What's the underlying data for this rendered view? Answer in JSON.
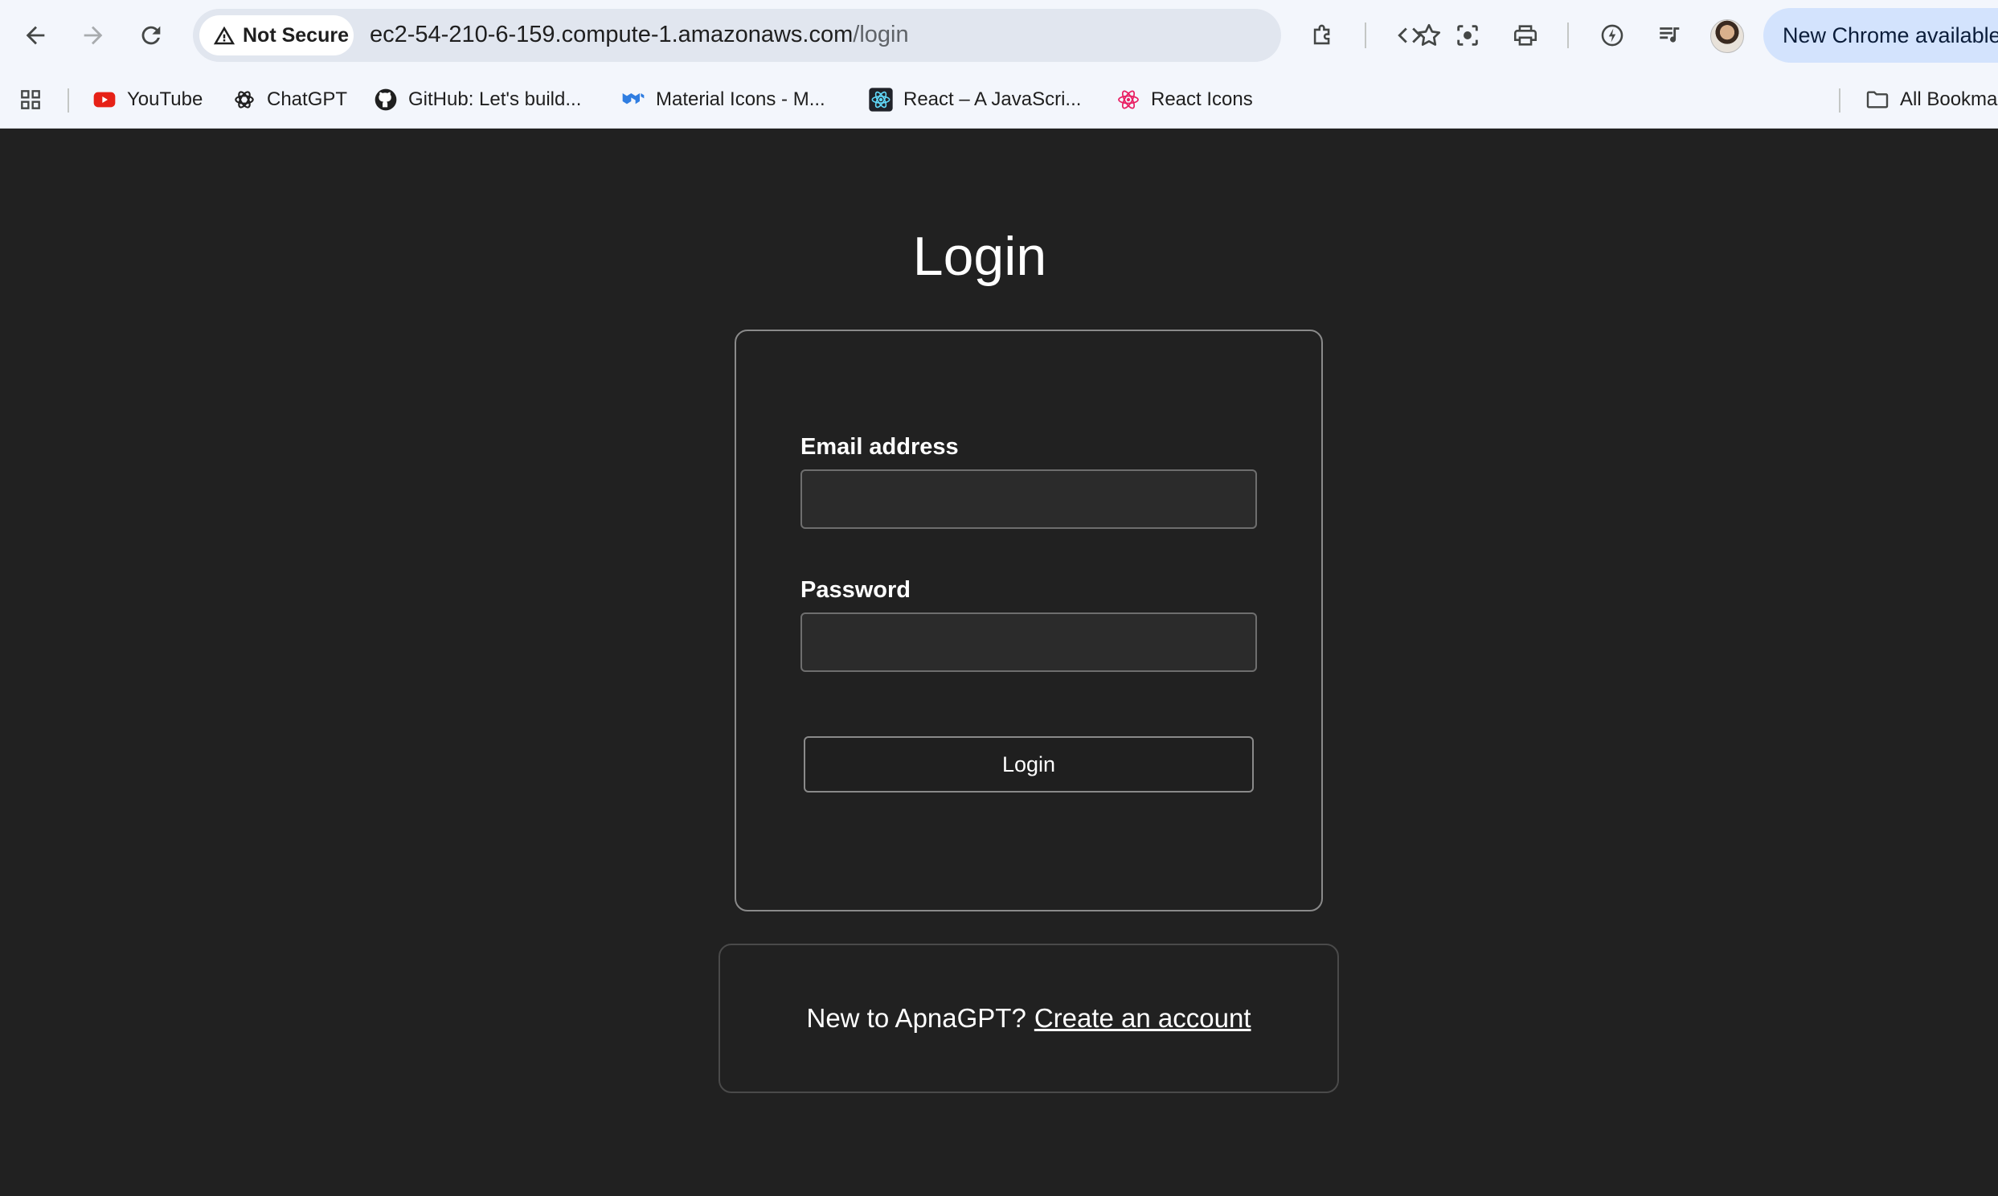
{
  "browser": {
    "security_label": "Not Secure",
    "url_host": "ec2-54-210-6-159.compute-1.amazonaws.com",
    "url_path": "/login",
    "update_label": "New Chrome available",
    "bookmarks": [
      {
        "label": "YouTube",
        "icon": "youtube-icon"
      },
      {
        "label": "ChatGPT",
        "icon": "chatgpt-icon"
      },
      {
        "label": "GitHub: Let's build...",
        "icon": "github-icon"
      },
      {
        "label": "Material Icons - M...",
        "icon": "material-ui-icon"
      },
      {
        "label": "React – A JavaScri...",
        "icon": "react-icon"
      },
      {
        "label": "React Icons",
        "icon": "react-icons-icon"
      }
    ],
    "all_bookmarks_label": "All Bookmarks"
  },
  "page": {
    "title": "Login",
    "email_label": "Email address",
    "email_value": "",
    "password_label": "Password",
    "password_value": "",
    "login_button": "Login",
    "signup_prompt": "New to ApnaGPT?",
    "signup_link": "Create an account"
  },
  "colors": {
    "background": "#212121",
    "chrome_bar": "#f3f6fc",
    "update_pill": "#d3e3fd"
  }
}
